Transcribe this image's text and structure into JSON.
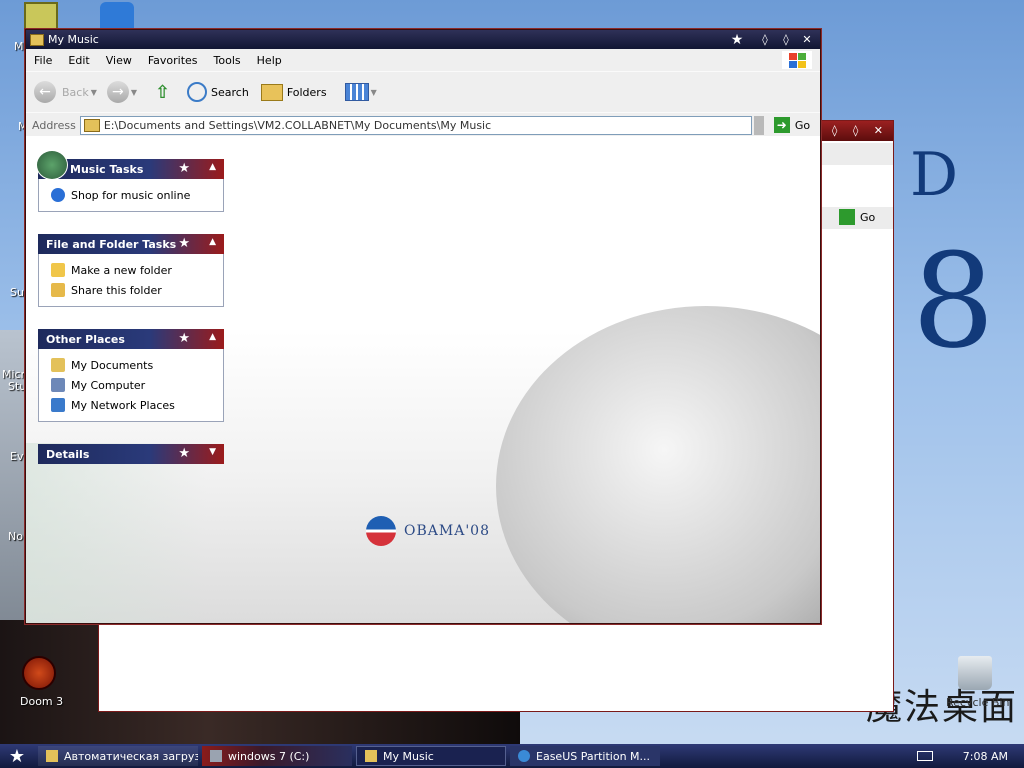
{
  "window": {
    "title": "My Music",
    "menu": [
      "File",
      "Edit",
      "View",
      "Favorites",
      "Tools",
      "Help"
    ],
    "toolbar": {
      "back_label": "Back",
      "search_label": "Search",
      "folders_label": "Folders"
    },
    "address": {
      "label": "Address",
      "value": "E:\\Documents and Settings\\VM2.COLLABNET\\My Documents\\My Music",
      "go_label": "Go"
    },
    "panels": [
      {
        "title": "Music Tasks",
        "expanded": true,
        "items": [
          {
            "label": "Shop for music online",
            "icon": "globe-icon"
          }
        ]
      },
      {
        "title": "File and Folder Tasks",
        "expanded": true,
        "items": [
          {
            "label": "Make a new folder",
            "icon": "new-folder-icon"
          },
          {
            "label": "Share this folder",
            "icon": "share-folder-icon"
          }
        ]
      },
      {
        "title": "Other Places",
        "expanded": true,
        "items": [
          {
            "label": "My Documents",
            "icon": "documents-icon"
          },
          {
            "label": "My Computer",
            "icon": "computer-icon"
          },
          {
            "label": "My Network Places",
            "icon": "network-icon"
          }
        ]
      },
      {
        "title": "Details",
        "expanded": false,
        "items": []
      }
    ],
    "background_brand": "OBAMA'08"
  },
  "bg_window": {
    "go_label": "Go"
  },
  "desktop": {
    "icons": [
      {
        "label": "Doom 3",
        "icon": "doom-icon"
      },
      {
        "label": "Recycle Bin",
        "icon": "recycle-bin-icon"
      }
    ],
    "partial_labels": [
      "M",
      "M",
      "Su",
      "Micro",
      "Stu",
      "Ev",
      "No"
    ],
    "big_text": [
      "D",
      "8"
    ],
    "watermark": "魔法桌面"
  },
  "taskbar": {
    "items": [
      {
        "label": "Автоматическая загрузка",
        "icon": "mail-icon"
      },
      {
        "label": "windows 7 (C:)",
        "icon": "drive-icon"
      },
      {
        "label": "My Music",
        "icon": "folder-icon",
        "active": true
      },
      {
        "label": "EaseUS Partition M...",
        "icon": "easeus-icon"
      }
    ],
    "clock": "7:08 AM"
  },
  "colors": {
    "title_dark": "#111633",
    "panel_blue": "#1e2a5c",
    "panel_red": "#9b1b1b",
    "taskbar": "#111a3d"
  }
}
